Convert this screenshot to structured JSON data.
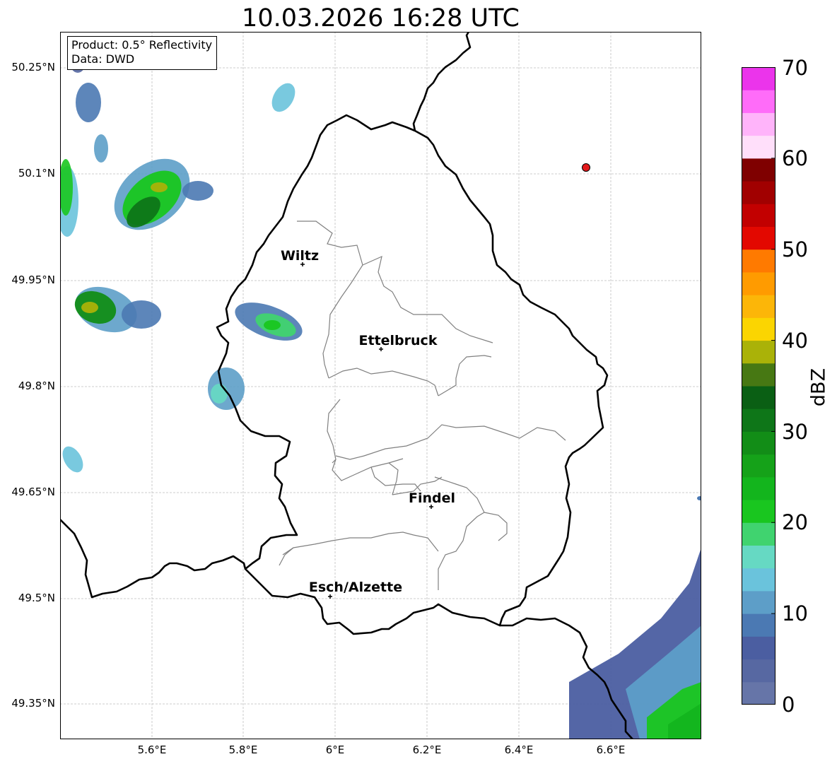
{
  "title": "10.03.2026 16:28 UTC",
  "info_box": {
    "product": "Product: 0.5° Reflectivity",
    "data": "Data: DWD"
  },
  "axes": {
    "lat_ticks": [
      "50.25°N",
      "50.1°N",
      "49.95°N",
      "49.8°N",
      "49.65°N",
      "49.5°N",
      "49.35°N"
    ],
    "lon_ticks": [
      "5.6°E",
      "5.8°E",
      "6°E",
      "6.2°E",
      "6.4°E",
      "6.6°E"
    ],
    "grid": true
  },
  "cities": [
    {
      "name": "Wiltz"
    },
    {
      "name": "Ettelbruck"
    },
    {
      "name": "Findel"
    },
    {
      "name": "Esch/Alzette"
    }
  ],
  "colorbar": {
    "label": "dBZ",
    "min": 0,
    "max": 70,
    "tick_labels": [
      "0",
      "10",
      "20",
      "30",
      "40",
      "50",
      "60",
      "70"
    ],
    "colors": [
      "#6675a8",
      "#5768a2",
      "#4b5ea1",
      "#4b79b3",
      "#5d9ec8",
      "#6ac3dc",
      "#66d9c3",
      "#40d36f",
      "#19c61f",
      "#13b51d",
      "#15a219",
      "#128d17",
      "#0e7618",
      "#0a5f14",
      "#477813",
      "#aab208",
      "#fbd501",
      "#fcb608",
      "#ff9b00",
      "#ff7a00",
      "#e30800",
      "#c20000",
      "#a10000",
      "#7f0000",
      "#ffdffa",
      "#ffb4fa",
      "#ff6cf9",
      "#eb34eb"
    ]
  },
  "radar_site_marker": {
    "color": "#e31a1c"
  },
  "colors": {
    "border_national": "#000000",
    "border_cantonal": "#808080",
    "grid": "#bfbfbf"
  }
}
